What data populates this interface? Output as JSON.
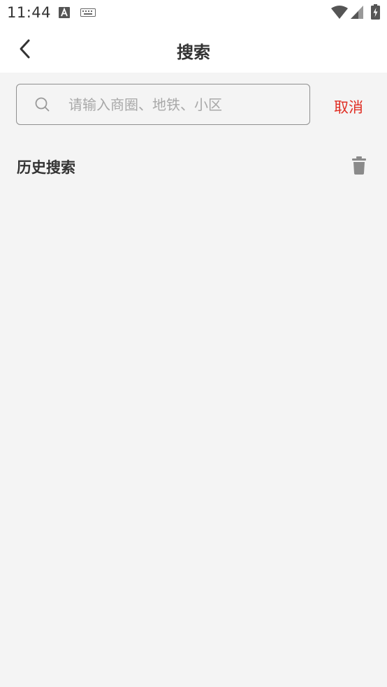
{
  "status_bar": {
    "time": "11:44",
    "icons": [
      "text-a-icon",
      "keyboard-icon",
      "wifi-icon",
      "signal-icon",
      "battery-charging-icon"
    ]
  },
  "header": {
    "title": "搜索",
    "back_icon": "chevron-left-icon"
  },
  "search": {
    "placeholder": "请输入商圈、地铁、小区",
    "value": "",
    "icon": "search-icon"
  },
  "cancel_label": "取消",
  "history": {
    "title": "历史搜索",
    "clear_icon": "trash-icon",
    "items": []
  },
  "colors": {
    "accent": "#e02e24",
    "background": "#f4f4f4",
    "text": "#333333",
    "placeholder": "#a8a8a8"
  }
}
